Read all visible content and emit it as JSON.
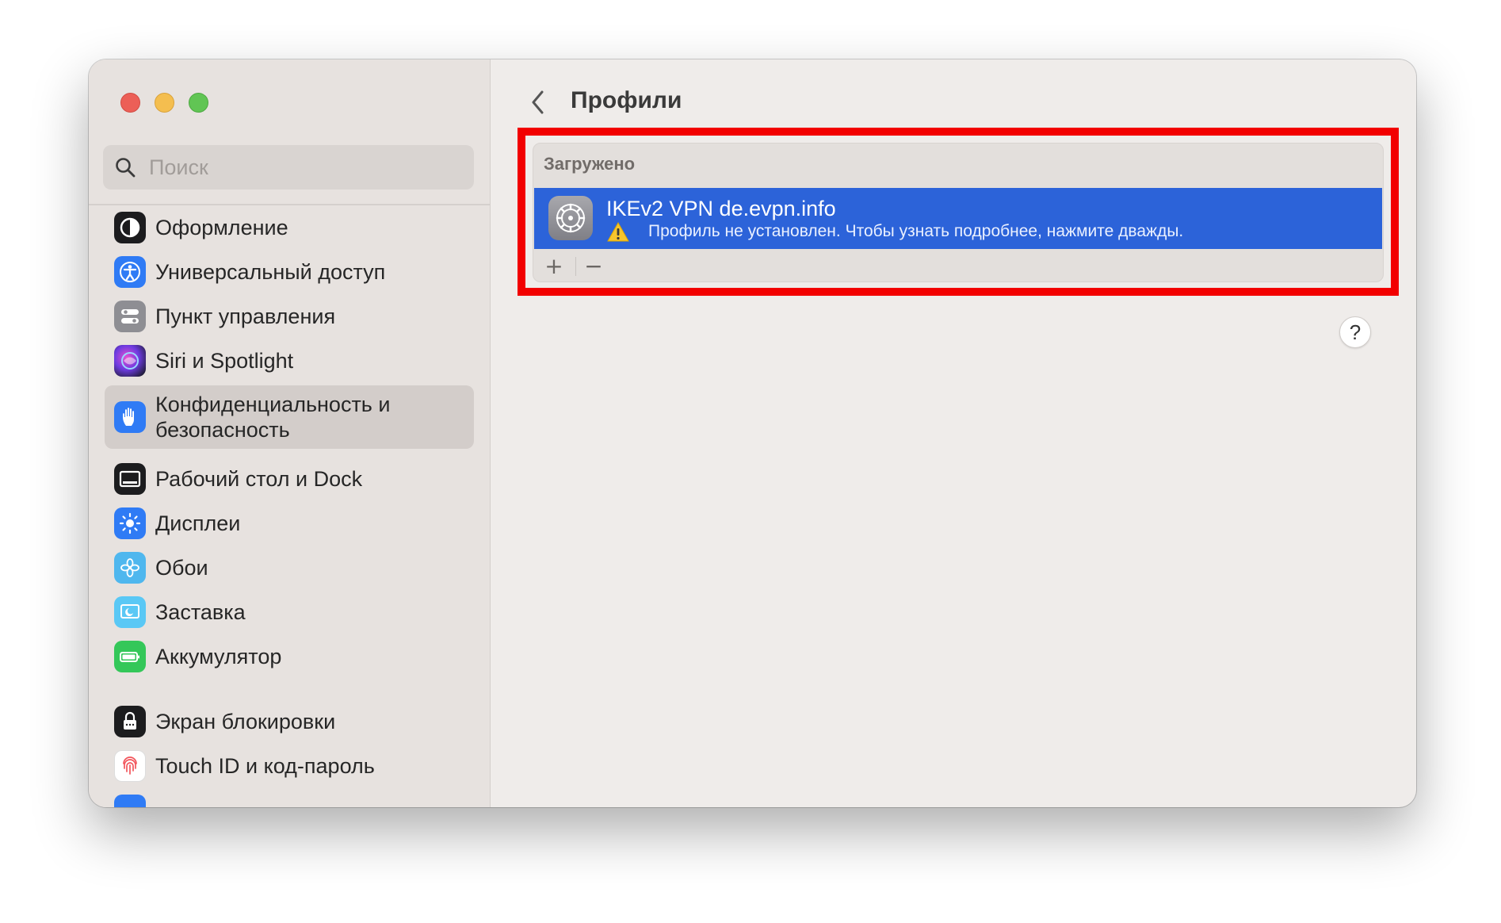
{
  "window": {
    "traffic_lights": [
      "close",
      "minimize",
      "zoom"
    ]
  },
  "sidebar": {
    "search": {
      "placeholder": "Поиск",
      "value": ""
    },
    "items": [
      {
        "label": "Оформление",
        "icon": "appearance-icon",
        "selected": false
      },
      {
        "label": "Универсальный доступ",
        "icon": "accessibility-icon",
        "selected": false
      },
      {
        "label": "Пункт управления",
        "icon": "control-center-icon",
        "selected": false
      },
      {
        "label": "Siri и Spotlight",
        "icon": "siri-icon",
        "selected": false
      },
      {
        "label": "Конфиденциальность и безопасность",
        "icon": "privacy-hand-icon",
        "selected": true
      },
      {
        "label": "Рабочий стол и Dock",
        "icon": "desktop-dock-icon",
        "selected": false
      },
      {
        "label": "Дисплеи",
        "icon": "displays-icon",
        "selected": false
      },
      {
        "label": "Обои",
        "icon": "wallpaper-icon",
        "selected": false
      },
      {
        "label": "Заставка",
        "icon": "screensaver-icon",
        "selected": false
      },
      {
        "label": "Аккумулятор",
        "icon": "battery-icon",
        "selected": false
      },
      {
        "label": "Экран блокировки",
        "icon": "lock-screen-icon",
        "selected": false
      },
      {
        "label": "Touch ID и код-пароль",
        "icon": "fingerprint-icon",
        "selected": false
      }
    ]
  },
  "header": {
    "title": "Профили",
    "back_icon": "chevron-left-icon"
  },
  "profiles": {
    "section_title": "Загружено",
    "items": [
      {
        "name": "IKEv2 VPN de.evpn.info",
        "status": "Профиль не установлен. Чтобы узнать подробнее, нажмите дважды.",
        "icon": "settings-gear-icon",
        "status_icon": "warning-icon",
        "selected": true
      }
    ],
    "add_label": "+",
    "remove_label": "−"
  },
  "help": {
    "label": "?"
  },
  "colors": {
    "selection": "#2c63d9",
    "annotation_box": "#f20000",
    "sidebar_bg": "#e7e2df",
    "content_bg": "#efecea"
  }
}
